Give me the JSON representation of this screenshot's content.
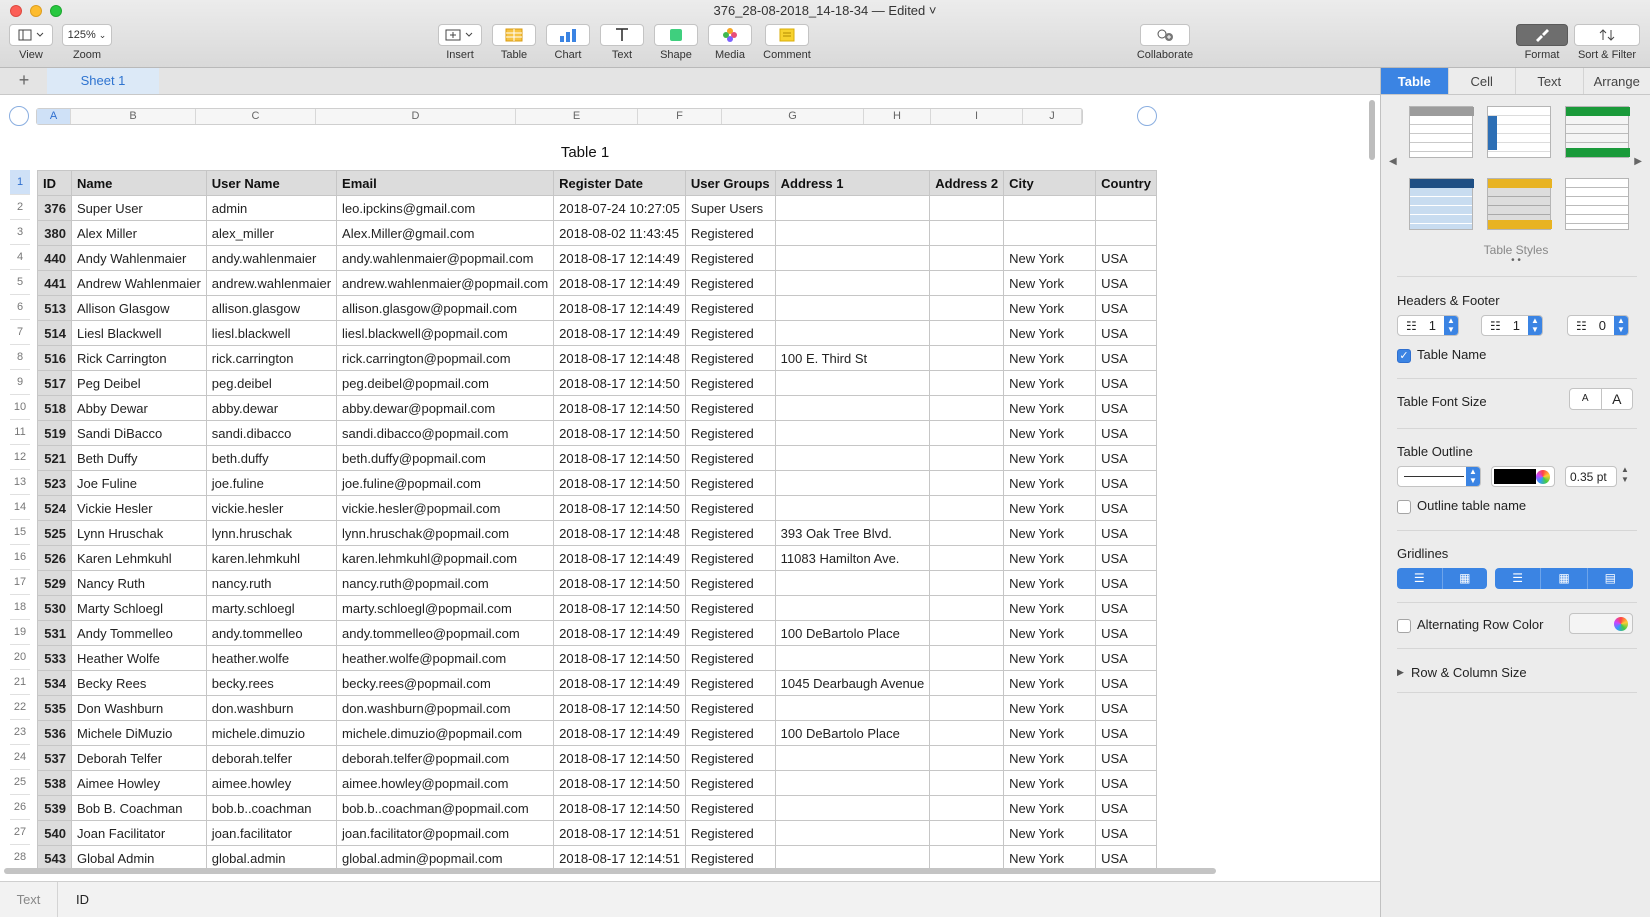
{
  "window": {
    "title": "376_28-08-2018_14-18-34 — Edited ˅"
  },
  "toolbar": {
    "view": "View",
    "zoom_value": "125%",
    "zoom": "Zoom",
    "insert": "Insert",
    "table": "Table",
    "chart": "Chart",
    "text": "Text",
    "shape": "Shape",
    "media": "Media",
    "comment": "Comment",
    "collaborate": "Collaborate",
    "format": "Format",
    "sort_filter": "Sort & Filter"
  },
  "sheets": {
    "add": "+",
    "tabs": [
      "Sheet 1"
    ]
  },
  "columns": [
    "A",
    "B",
    "C",
    "D",
    "E",
    "F",
    "G",
    "H",
    "I",
    "J"
  ],
  "table": {
    "title": "Table 1",
    "headers": [
      "ID",
      "Name",
      "User Name",
      "Email",
      "Register Date",
      "User Groups",
      "Address 1",
      "Address 2",
      "City",
      "Country"
    ],
    "rows": [
      [
        "376",
        "Super User",
        "admin",
        "leo.ipckins@gmail.com",
        "2018-07-24 10:27:05",
        "Super Users",
        "",
        "",
        "",
        ""
      ],
      [
        "380",
        "Alex Miller",
        "alex_miller",
        "Alex.Miller@gmail.com",
        "2018-08-02 11:43:45",
        "Registered",
        "",
        "",
        "",
        ""
      ],
      [
        "440",
        "Andy Wahlenmaier",
        "andy.wahlenmaier",
        "andy.wahlenmaier@popmail.com",
        "2018-08-17 12:14:49",
        "Registered",
        "",
        "",
        "New York",
        "USA"
      ],
      [
        "441",
        "Andrew Wahlenmaier",
        "andrew.wahlenmaier",
        "andrew.wahlenmaier@popmail.com",
        "2018-08-17 12:14:49",
        "Registered",
        "",
        "",
        "New York",
        "USA"
      ],
      [
        "513",
        "Allison Glasgow",
        "allison.glasgow",
        "allison.glasgow@popmail.com",
        "2018-08-17 12:14:49",
        "Registered",
        "",
        "",
        "New York",
        "USA"
      ],
      [
        "514",
        "Liesl Blackwell",
        "liesl.blackwell",
        "liesl.blackwell@popmail.com",
        "2018-08-17 12:14:49",
        "Registered",
        "",
        "",
        "New York",
        "USA"
      ],
      [
        "516",
        "Rick Carrington",
        "rick.carrington",
        "rick.carrington@popmail.com",
        "2018-08-17 12:14:48",
        "Registered",
        "100 E. Third St",
        "",
        "New York",
        "USA"
      ],
      [
        "517",
        "Peg Deibel",
        "peg.deibel",
        "peg.deibel@popmail.com",
        "2018-08-17 12:14:50",
        "Registered",
        "",
        "",
        "New York",
        "USA"
      ],
      [
        "518",
        "Abby Dewar",
        "abby.dewar",
        "abby.dewar@popmail.com",
        "2018-08-17 12:14:50",
        "Registered",
        "",
        "",
        "New York",
        "USA"
      ],
      [
        "519",
        "Sandi DiBacco",
        "sandi.dibacco",
        "sandi.dibacco@popmail.com",
        "2018-08-17 12:14:50",
        "Registered",
        "",
        "",
        "New York",
        "USA"
      ],
      [
        "521",
        "Beth Duffy",
        "beth.duffy",
        "beth.duffy@popmail.com",
        "2018-08-17 12:14:50",
        "Registered",
        "",
        "",
        "New York",
        "USA"
      ],
      [
        "523",
        "Joe Fuline",
        "joe.fuline",
        "joe.fuline@popmail.com",
        "2018-08-17 12:14:50",
        "Registered",
        "",
        "",
        "New York",
        "USA"
      ],
      [
        "524",
        "Vickie Hesler",
        "vickie.hesler",
        "vickie.hesler@popmail.com",
        "2018-08-17 12:14:50",
        "Registered",
        "",
        "",
        "New York",
        "USA"
      ],
      [
        "525",
        "Lynn Hruschak",
        "lynn.hruschak",
        "lynn.hruschak@popmail.com",
        "2018-08-17 12:14:48",
        "Registered",
        "393 Oak Tree Blvd.",
        "",
        "New York",
        "USA"
      ],
      [
        "526",
        "Karen Lehmkuhl",
        "karen.lehmkuhl",
        "karen.lehmkuhl@popmail.com",
        "2018-08-17 12:14:49",
        "Registered",
        "11083 Hamilton Ave.",
        "",
        "New York",
        "USA"
      ],
      [
        "529",
        "Nancy Ruth",
        "nancy.ruth",
        "nancy.ruth@popmail.com",
        "2018-08-17 12:14:50",
        "Registered",
        "",
        "",
        "New York",
        "USA"
      ],
      [
        "530",
        "Marty Schloegl",
        "marty.schloegl",
        "marty.schloegl@popmail.com",
        "2018-08-17 12:14:50",
        "Registered",
        "",
        "",
        "New York",
        "USA"
      ],
      [
        "531",
        "Andy Tommelleo",
        "andy.tommelleo",
        "andy.tommelleo@popmail.com",
        "2018-08-17 12:14:49",
        "Registered",
        "100 DeBartolo Place",
        "",
        "New York",
        "USA"
      ],
      [
        "533",
        "Heather Wolfe",
        "heather.wolfe",
        "heather.wolfe@popmail.com",
        "2018-08-17 12:14:50",
        "Registered",
        "",
        "",
        "New York",
        "USA"
      ],
      [
        "534",
        "Becky Rees",
        "becky.rees",
        "becky.rees@popmail.com",
        "2018-08-17 12:14:49",
        "Registered",
        "1045 Dearbaugh Avenue",
        "",
        "New York",
        "USA"
      ],
      [
        "535",
        "Don Washburn",
        "don.washburn",
        "don.washburn@popmail.com",
        "2018-08-17 12:14:50",
        "Registered",
        "",
        "",
        "New York",
        "USA"
      ],
      [
        "536",
        "Michele DiMuzio",
        "michele.dimuzio",
        "michele.dimuzio@popmail.com",
        "2018-08-17 12:14:49",
        "Registered",
        "100 DeBartolo Place",
        "",
        "New York",
        "USA"
      ],
      [
        "537",
        "Deborah Telfer",
        "deborah.telfer",
        "deborah.telfer@popmail.com",
        "2018-08-17 12:14:50",
        "Registered",
        "",
        "",
        "New York",
        "USA"
      ],
      [
        "538",
        "Aimee Howley",
        "aimee.howley",
        "aimee.howley@popmail.com",
        "2018-08-17 12:14:50",
        "Registered",
        "",
        "",
        "New York",
        "USA"
      ],
      [
        "539",
        "Bob B. Coachman",
        "bob.b..coachman",
        "bob.b..coachman@popmail.com",
        "2018-08-17 12:14:50",
        "Registered",
        "",
        "",
        "New York",
        "USA"
      ],
      [
        "540",
        "Joan Facilitator",
        "joan.facilitator",
        "joan.facilitator@popmail.com",
        "2018-08-17 12:14:51",
        "Registered",
        "",
        "",
        "New York",
        "USA"
      ],
      [
        "543",
        "Global Admin",
        "global.admin",
        "global.admin@popmail.com",
        "2018-08-17 12:14:51",
        "Registered",
        "",
        "",
        "New York",
        "USA"
      ]
    ]
  },
  "bottom": {
    "mode": "Text",
    "value": "ID"
  },
  "inspector": {
    "tabs": [
      "Table",
      "Cell",
      "Text",
      "Arrange"
    ],
    "styles_label": "Table Styles",
    "headers_footer": "Headers & Footer",
    "header_rows": "1",
    "header_cols": "1",
    "footer_rows": "0",
    "table_name": "Table Name",
    "font_size": "Table Font Size",
    "font_small": "A",
    "font_large": "A",
    "outline": "Table Outline",
    "outline_width": "0.35 pt",
    "outline_name": "Outline table name",
    "gridlines": "Gridlines",
    "alt_row": "Alternating Row Color",
    "row_col_size": "Row & Column Size"
  },
  "colors": {
    "accent": "#3b84e3",
    "header_fill": "#dcdcdc",
    "style_green": "#1a9a3a",
    "style_yellow": "#e8b322",
    "style_blue": "#2d6fb5"
  }
}
